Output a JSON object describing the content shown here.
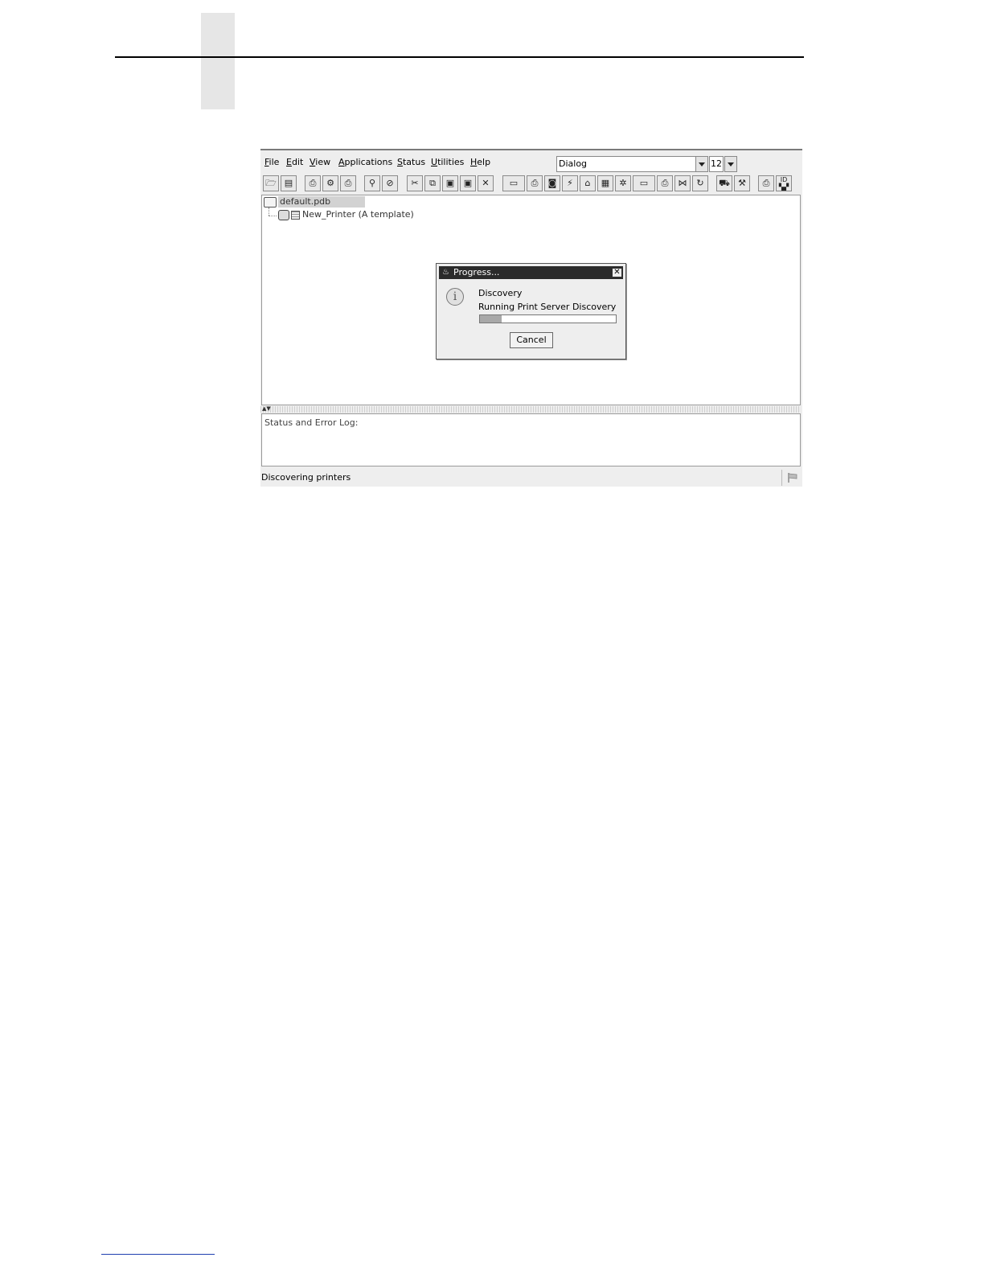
{
  "menubar": {
    "items": [
      {
        "mnemonic": "F",
        "rest": "ile"
      },
      {
        "mnemonic": "E",
        "rest": "dit"
      },
      {
        "mnemonic": "V",
        "rest": "iew"
      },
      {
        "mnemonic": "A",
        "rest": "pplications"
      },
      {
        "mnemonic": "S",
        "rest": "tatus"
      },
      {
        "mnemonic": "U",
        "rest": "tilities"
      },
      {
        "mnemonic": "H",
        "rest": "elp"
      }
    ]
  },
  "font_selector": {
    "family": "Dialog",
    "size": "12"
  },
  "tree": {
    "root_label": "default.pdb",
    "child_label": "New_Printer (A template)"
  },
  "log": {
    "label": "Status and Error Log:"
  },
  "statusbar": {
    "text": "Discovering printers"
  },
  "dialog": {
    "title": "Progress...",
    "heading": "Discovery",
    "message": "Running Print Server Discovery",
    "progress_fraction": 0.16,
    "cancel_label": "Cancel"
  },
  "colors": {
    "title_bar": "#2b2b2b",
    "window_bg": "#eeeeee",
    "footer_rule": "#1f3fb0"
  }
}
